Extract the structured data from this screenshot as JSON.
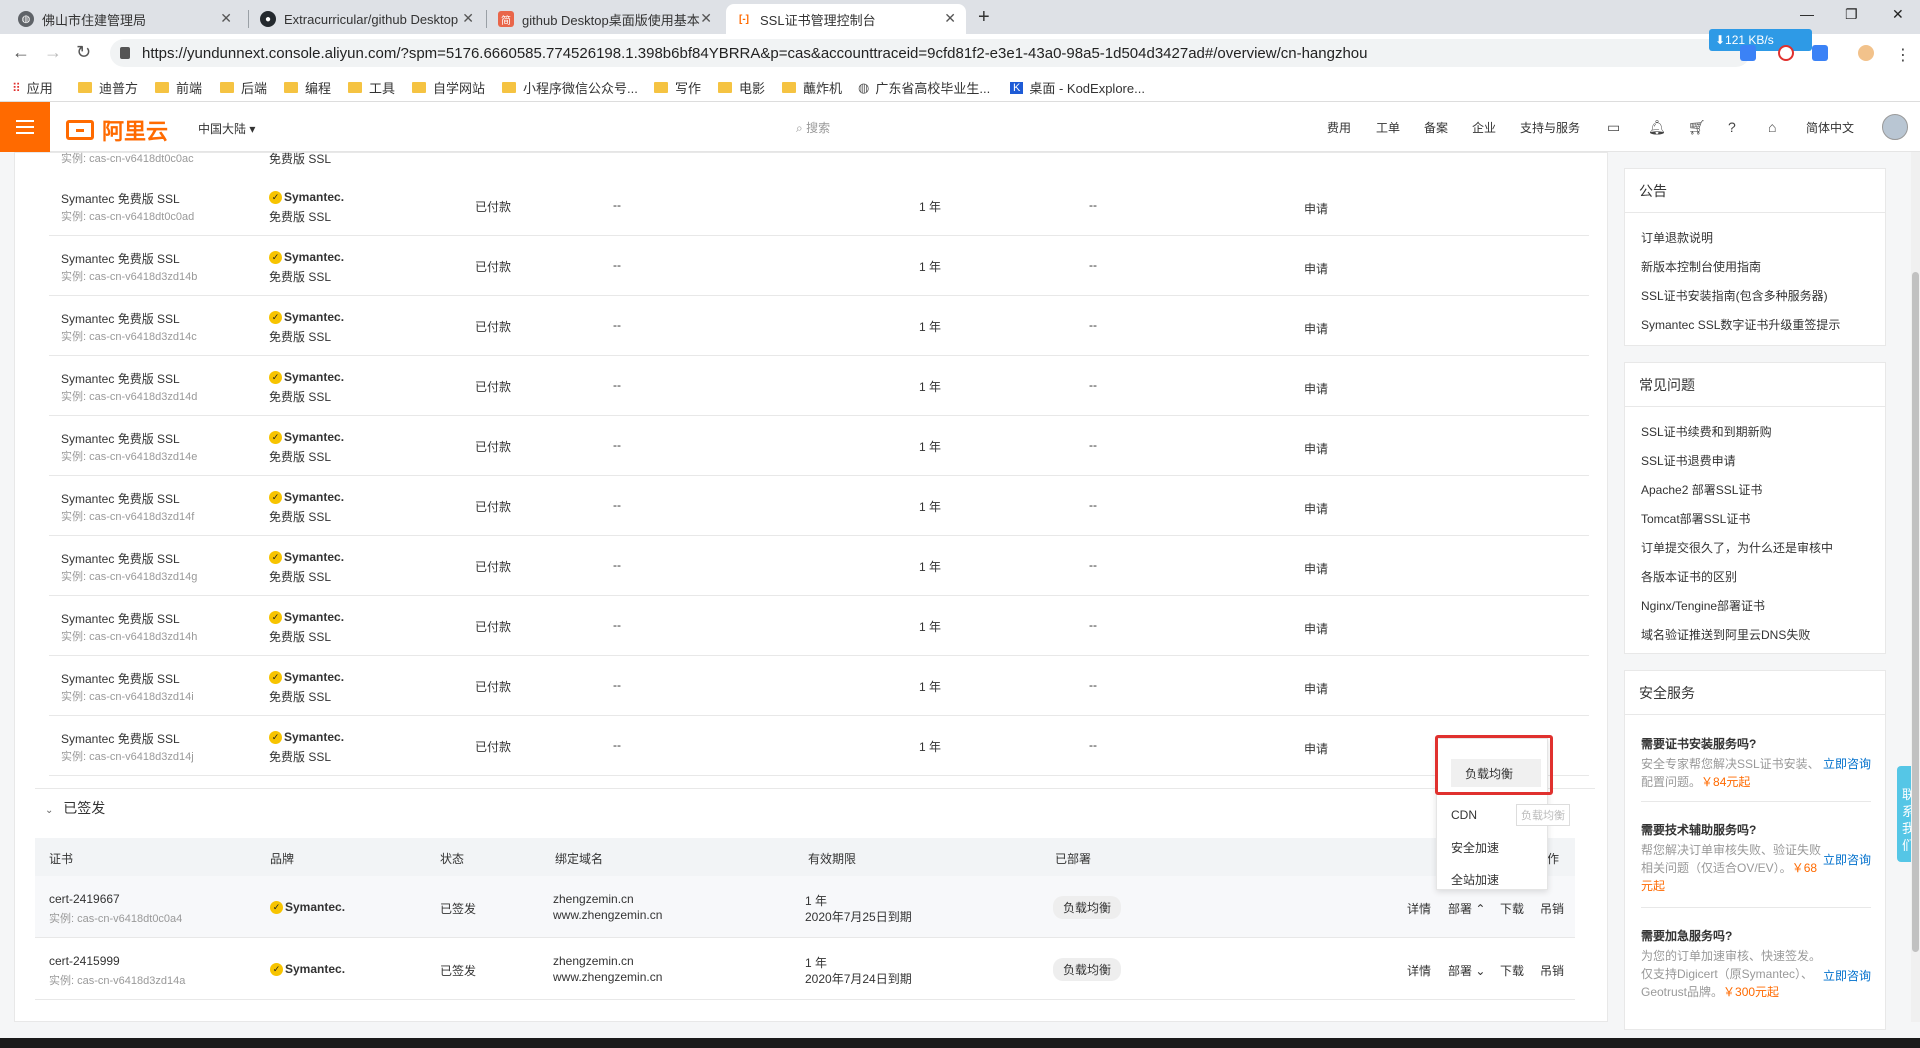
{
  "browser": {
    "tabs": [
      {
        "title": "佛山市住建管理局",
        "icon": "globe-icon",
        "color": "#5f6368"
      },
      {
        "title": "Extracurricular/github Desktop",
        "icon": "github-icon",
        "color": "#24292e"
      },
      {
        "title": "github Desktop桌面版使用基本",
        "icon": "jianshu-icon",
        "color": "#e9664a"
      },
      {
        "title": "SSL证书管理控制台",
        "icon": "aliyun-icon",
        "color": "#ff6a00"
      }
    ],
    "url": "https://yundunnext.console.aliyun.com/?spm=5176.6660585.774526198.1.398b6bf84YBRRA&p=cas&accounttraceid=9cfd81f2-e3e1-43a0-98a5-1d504d3427ad#/overview/cn-hangzhou",
    "speed": "⬇121 KB/s",
    "bookmarks": [
      "应用",
      "迪普方",
      "前端",
      "后端",
      "编程",
      "工具",
      "自学网站",
      "小程序微信公众号...",
      "写作",
      "电影",
      "蘸炸机",
      "广东省高校毕业生...",
      "桌面 - KodExplore..."
    ]
  },
  "header": {
    "logo": "阿里云",
    "region": "中国大陆 ▾",
    "search_placeholder": "搜索",
    "nav": [
      "费用",
      "工单",
      "备案",
      "企业",
      "支持与服务"
    ],
    "language": "简体中文"
  },
  "pending": {
    "top_cut_instance": "实例: cas-cn-v6418dt0c0ac",
    "top_cut_brand_sub": "免费版 SSL",
    "rows": [
      {
        "name": "Symantec 免费版 SSL",
        "instance": "实例: cas-cn-v6418dt0c0ad"
      },
      {
        "name": "Symantec 免费版 SSL",
        "instance": "实例: cas-cn-v6418d3zd14b"
      },
      {
        "name": "Symantec 免费版 SSL",
        "instance": "实例: cas-cn-v6418d3zd14c"
      },
      {
        "name": "Symantec 免费版 SSL",
        "instance": "实例: cas-cn-v6418d3zd14d"
      },
      {
        "name": "Symantec 免费版 SSL",
        "instance": "实例: cas-cn-v6418d3zd14e"
      },
      {
        "name": "Symantec 免费版 SSL",
        "instance": "实例: cas-cn-v6418d3zd14f"
      },
      {
        "name": "Symantec 免费版 SSL",
        "instance": "实例: cas-cn-v6418d3zd14g"
      },
      {
        "name": "Symantec 免费版 SSL",
        "instance": "实例: cas-cn-v6418d3zd14h"
      },
      {
        "name": "Symantec 免费版 SSL",
        "instance": "实例: cas-cn-v6418d3zd14i"
      },
      {
        "name": "Symantec 免费版 SSL",
        "instance": "实例: cas-cn-v6418d3zd14j"
      }
    ],
    "brand": "Symantec.",
    "brand_sub": "免费版 SSL",
    "status": "已付款",
    "dash": "--",
    "period": "1 年",
    "action": "申请"
  },
  "issued": {
    "section_title": "已签发",
    "headers": [
      "证书",
      "品牌",
      "状态",
      "绑定域名",
      "有效期限",
      "已部署",
      "作"
    ],
    "rows": [
      {
        "cert": "cert-2419667",
        "instance": "实例: cas-cn-v6418dt0c0a4",
        "brand": "Symantec.",
        "status": "已签发",
        "domain1": "zhengzemin.cn",
        "domain2": "www.zhengzemin.cn",
        "period": "1 年",
        "expire": "2020年7月25日到期",
        "deployed": "负载均衡",
        "deploy_label": "部署 ⌃"
      },
      {
        "cert": "cert-2415999",
        "instance": "实例: cas-cn-v6418d3zd14a",
        "brand": "Symantec.",
        "status": "已签发",
        "domain1": "zhengzemin.cn",
        "domain2": "www.zhengzemin.cn",
        "period": "1 年",
        "expire": "2020年7月24日到期",
        "deployed": "负载均衡",
        "deploy_label": "部署 ⌄"
      }
    ],
    "actions": {
      "detail": "详情",
      "download": "下载",
      "revoke": "吊销"
    }
  },
  "dropdown": {
    "items": [
      "负载均衡",
      "CDN",
      "安全加速",
      "全站加速"
    ],
    "tooltip": "负载均衡"
  },
  "sidebar": {
    "notice_title": "公告",
    "notices": [
      "订单退款说明",
      "新版本控制台使用指南",
      "SSL证书安装指南(包含多种服务器)",
      "Symantec SSL数字证书升级重签提示"
    ],
    "faq_title": "常见问题",
    "faqs": [
      "SSL证书续费和到期新购",
      "SSL证书退费申请",
      "Apache2 部署SSL证书",
      "Tomcat部署SSL证书",
      "订单提交很久了，为什么还是审核中",
      "各版本证书的区别",
      "Nginx/Tengine部署证书",
      "域名验证推送到阿里云DNS失败"
    ],
    "svc_title": "安全服务",
    "services": [
      {
        "title": "需要证书安装服务吗?",
        "desc": "安全专家帮您解决SSL证书安装、配置问题。",
        "price": "￥84元起",
        "link": "立即咨询"
      },
      {
        "title": "需要技术辅助服务吗?",
        "desc": "帮您解决订单审核失败、验证失败相关问题（仅适合OV/EV）。",
        "price": "￥68元起",
        "link": "立即咨询"
      },
      {
        "title": "需要加急服务吗?",
        "desc": "为您的订单加速审核、快速签发。仅支持Digicert（原Symantec）、Geotrust品牌。",
        "price": "￥300元起",
        "link": "立即咨询"
      }
    ]
  },
  "contact": "联系我们"
}
